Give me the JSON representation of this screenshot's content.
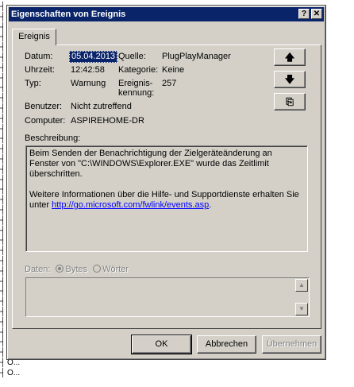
{
  "background": {
    "rows": [
      "",
      "",
      "",
      "",
      "",
      "",
      "",
      "",
      "",
      "",
      "",
      "",
      "",
      "",
      "",
      "",
      "",
      "",
      "",
      "",
      "",
      "",
      "",
      "",
      "",
      "",
      "",
      "",
      "",
      "",
      "",
      "",
      "",
      "",
      "O...",
      "O...",
      "O..."
    ]
  },
  "dialog": {
    "title": "Eigenschaften von Ereignis",
    "help_glyph": "?",
    "close_glyph": "✕",
    "tab": "Ereignis",
    "labels": {
      "datum": "Datum:",
      "uhrzeit": "Uhrzeit:",
      "typ": "Typ:",
      "quelle": "Quelle:",
      "kategorie": "Kategorie:",
      "kennung_1": "Ereignis-",
      "kennung_2": "kennung:",
      "benutzer": "Benutzer:",
      "computer": "Computer:",
      "beschreibung": "Beschreibung:",
      "daten": "Daten:",
      "bytes": "Bytes",
      "woerter": "Wörter"
    },
    "values": {
      "datum": "05.04.2013",
      "uhrzeit": "12:42:58",
      "typ": "Warnung",
      "quelle": "PlugPlayManager",
      "kategorie": "Keine",
      "kennung": "257",
      "benutzer": "Nicht zutreffend",
      "computer": "ASPIREHOME-DR"
    },
    "description": {
      "line1": "Beim Senden der Benachrichtigung der Zielgeräteänderung an Fenster von \"C:\\WINDOWS\\Explorer.EXE\" wurde das Zeitlimit überschritten.",
      "line2_prefix": "Weitere Informationen über die Hilfe- und Supportdienste erhalten Sie unter ",
      "link": "http://go.microsoft.com/fwlink/events.asp",
      "line2_suffix": "."
    },
    "side_buttons": {
      "up": "🡅",
      "down": "🡇",
      "copy": "⎘"
    },
    "buttons": {
      "ok": "OK",
      "cancel": "Abbrechen",
      "apply": "Übernehmen"
    }
  }
}
